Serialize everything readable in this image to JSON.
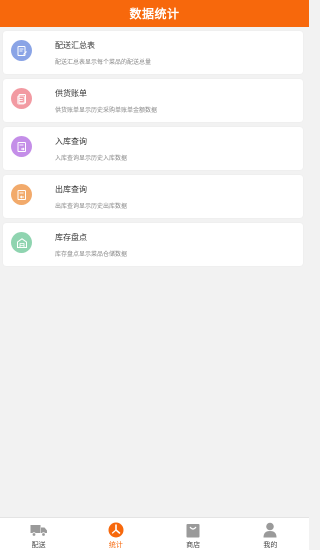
{
  "header": {
    "title": "数据统计"
  },
  "items": [
    {
      "title": "配送汇总表",
      "desc": "配送汇总表显示每个菜品的配送总量",
      "icon": "document-edit-icon",
      "color": "#8aa4e6"
    },
    {
      "title": "供货账单",
      "desc": "供货账单显示历史采购单账单金额数据",
      "icon": "documents-icon",
      "color": "#f29aa2"
    },
    {
      "title": "入库查询",
      "desc": "入库查询显示历史入库数据",
      "icon": "inbound-icon",
      "color": "#c48ee8"
    },
    {
      "title": "出库查询",
      "desc": "出库查询显示历史出库数据",
      "icon": "outbound-icon",
      "color": "#f2aa6b"
    },
    {
      "title": "库存盘点",
      "desc": "库存盘点显示菜品仓储数据",
      "icon": "warehouse-icon",
      "color": "#8fd4b0"
    }
  ],
  "tabs": [
    {
      "label": "配送",
      "icon": "truck-icon",
      "active": false
    },
    {
      "label": "统计",
      "icon": "chart-icon",
      "active": true
    },
    {
      "label": "商店",
      "icon": "shopping-bag-icon",
      "active": false
    },
    {
      "label": "我的",
      "icon": "user-icon",
      "active": false
    }
  ],
  "colors": {
    "accent": "#f7680c",
    "tab_inactive": "#9a9a9a"
  }
}
